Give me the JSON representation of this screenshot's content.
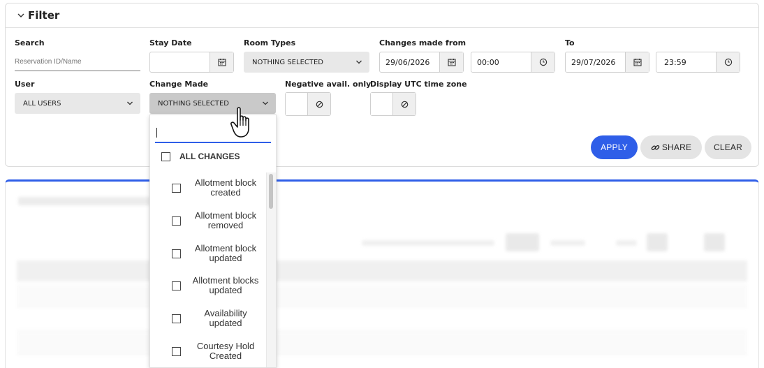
{
  "filter": {
    "title": "Filter",
    "search": {
      "label": "Search",
      "placeholder": "Reservation ID/Name"
    },
    "stay_date": {
      "label": "Stay Date",
      "value": ""
    },
    "room_types": {
      "label": "Room Types",
      "value": "NOTHING SELECTED"
    },
    "changes_from": {
      "label": "Changes made from",
      "date": "29/06/2026",
      "time": "00:00"
    },
    "to": {
      "label": "To",
      "date": "29/07/2026",
      "time": "23:59"
    },
    "user": {
      "label": "User",
      "value": "ALL USERS"
    },
    "change_made": {
      "label": "Change Made",
      "value": "NOTHING SELECTED"
    },
    "negative_avail": {
      "label": "Negative avail. only"
    },
    "utc": {
      "label": "Display UTC time zone"
    },
    "buttons": {
      "apply": "APPLY",
      "share": "SHARE",
      "clear": "CLEAR"
    }
  },
  "dropdown": {
    "search_value": "",
    "all_label": "ALL CHANGES",
    "items": [
      {
        "label": "Allotment block created"
      },
      {
        "label": "Allotment block removed"
      },
      {
        "label": "Allotment block updated"
      },
      {
        "label": "Allotment blocks updated"
      },
      {
        "label": "Availability updated"
      },
      {
        "label": "Courtesy Hold Created"
      }
    ]
  },
  "colors": {
    "accent": "#2f5ee8",
    "select_bg": "#e8e8e8",
    "select_active_bg": "#c9c9c9"
  },
  "icons": [
    "chevron-down-icon",
    "calendar-icon",
    "clock-icon",
    "ban-icon",
    "link-icon",
    "hand-cursor-icon"
  ]
}
